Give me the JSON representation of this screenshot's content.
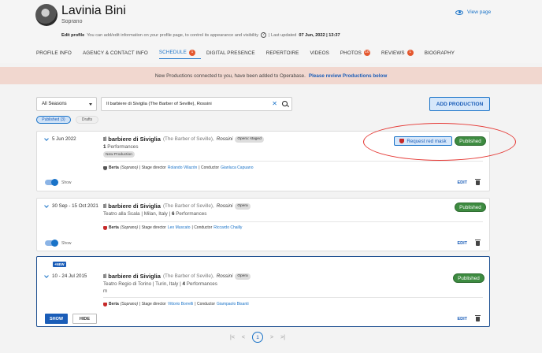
{
  "profile": {
    "name": "Lavinia Bini",
    "voice": "Soprano",
    "view_page": "View page"
  },
  "edit_line": {
    "label": "Edit profile",
    "text": "You can add/edit information on your profile page, to control its appearance and visibility",
    "updated_prefix": "| Last updated",
    "updated_value": "07 Jun, 2022 | 13:37"
  },
  "tabs": [
    {
      "label": "PROFILE INFO"
    },
    {
      "label": "AGENCY & CONTACT INFO"
    },
    {
      "label": "SCHEDULE",
      "badge": "1"
    },
    {
      "label": "DIGITAL PRESENCE"
    },
    {
      "label": "REPERTOIRE"
    },
    {
      "label": "VIDEOS"
    },
    {
      "label": "PHOTOS",
      "badge": "10"
    },
    {
      "label": "REVIEWS",
      "badge": "1"
    },
    {
      "label": "BIOGRAPHY"
    }
  ],
  "banner": {
    "text": "New Productions connected to you, have been added to Operabase.",
    "link": "Please review Productions below"
  },
  "filters": {
    "season": "All Seasons",
    "search_value": "Il barbiere di Siviglia (The Barber of Seville), Rossini",
    "add_button": "ADD PRODUCTION",
    "chip_published": "Published (3)",
    "chip_drafts": "Drafts"
  },
  "productions": [
    {
      "date": "5 Jun 2022",
      "title": "Il barbiere di Siviglia",
      "subtitle": "(The Barber of Seville),",
      "composer": "Rossini",
      "tag": "Opera: staged",
      "perf_count": "1",
      "perf_label": "Performances",
      "new_label": "New Production",
      "role_name": "Berta",
      "role_voice": "(Soprano)",
      "director_label": "| Stage director",
      "director": "Rolando Villazón",
      "conductor_label": "| Conductor",
      "conductor": "Gianluca Capuano",
      "show_label": "Show",
      "edit_label": "EDIT",
      "status": "Published",
      "request_mask": "Request red mask"
    },
    {
      "date": "30 Sep - 15 Oct 2021",
      "title": "Il barbiere di Siviglia",
      "subtitle": "(The Barber of Seville),",
      "composer": "Rossini",
      "tag": "Opera",
      "venue": "Teatro alla Scala",
      "city": "| Milan, Italy |",
      "perf_count": "6",
      "perf_label": "Performances",
      "role_name": "Berta",
      "role_voice": "(Soprano)",
      "director_label": "| Stage director",
      "director": "Leo Muscato",
      "conductor_label": "| Conductor",
      "conductor": "Riccardo Chailly",
      "show_label": "Show",
      "edit_label": "EDIT",
      "status": "Published"
    },
    {
      "new_badge": "+NEW",
      "date": "10 - 24 Jul 2015",
      "title": "Il barbiere di Siviglia",
      "subtitle": "(The Barber of Seville),",
      "composer": "Rossini",
      "tag": "Opera",
      "venue": "Teatro Regio di Torino",
      "city": "| Turin, Italy |",
      "perf_count": "4",
      "perf_label": "Performances",
      "extra": "m",
      "role_name": "Berta",
      "role_voice": "(Soprano)",
      "director_label": "| Stage director",
      "director": "Vittorio Borrelli",
      "conductor_label": "| Conductor",
      "conductor": "Giampaolo Bisanti",
      "show_button": "SHOW",
      "hide_button": "HIDE",
      "edit_label": "EDIT",
      "status": "Published"
    }
  ],
  "pagination": {
    "first": "|<",
    "prev": "<",
    "current": "1",
    "next": ">",
    "last": ">|"
  }
}
